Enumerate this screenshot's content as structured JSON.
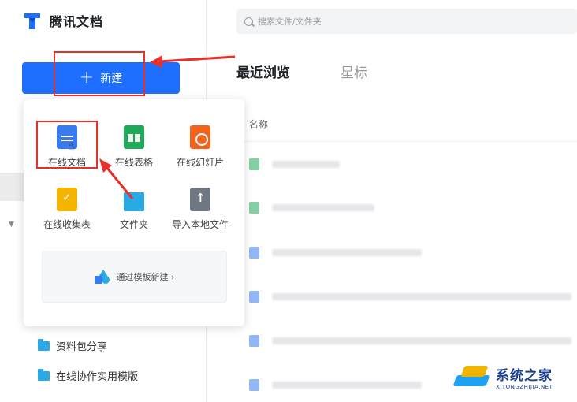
{
  "app": {
    "title": "腾讯文档"
  },
  "sidebar": {
    "new_button_label": "新建",
    "folders": [
      {
        "label": "资料包分享"
      },
      {
        "label": "在线协作实用模版"
      }
    ]
  },
  "new_menu": {
    "items": [
      {
        "label": "在线文档",
        "icon": "doc-icon"
      },
      {
        "label": "在线表格",
        "icon": "sheet-icon"
      },
      {
        "label": "在线幻灯片",
        "icon": "slides-icon"
      },
      {
        "label": "在线收集表",
        "icon": "form-icon"
      },
      {
        "label": "文件夹",
        "icon": "folder-icon"
      },
      {
        "label": "导入本地文件",
        "icon": "upload-icon"
      }
    ],
    "template_link": "通过模板新建 ›"
  },
  "main": {
    "search_placeholder": "搜索文件/文件夹",
    "tabs": [
      {
        "label": "最近浏览",
        "active": true
      },
      {
        "label": "星标",
        "active": false
      }
    ],
    "column_header": "名称"
  },
  "watermark": {
    "main": "系统之家",
    "sub": "XITONGZHIJIA.NET"
  },
  "colors": {
    "primary": "#1e6fff",
    "annotation_red": "#e8302b"
  }
}
